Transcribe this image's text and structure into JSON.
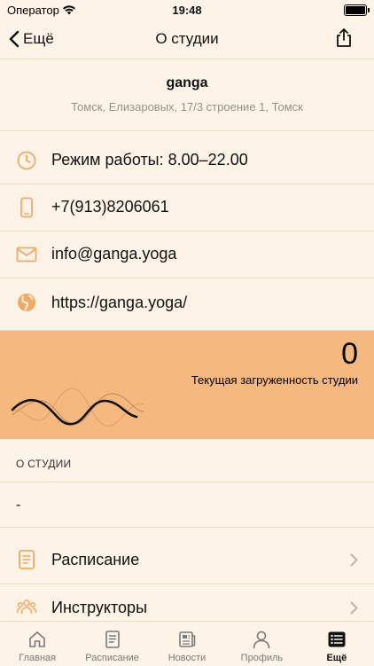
{
  "status_bar": {
    "carrier": "Оператор",
    "time": "19:48"
  },
  "nav": {
    "back_label": "Ещё",
    "title": "О студии"
  },
  "studio": {
    "name": "ganga",
    "address": "Томск, Елизаровых, 17/3 строение 1, Томск"
  },
  "contacts": {
    "hours": "Режим работы: 8.00–22.00",
    "phone": "+7(913)8206061",
    "email": "info@ganga.yoga",
    "website": "https://ganga.yoga/"
  },
  "load": {
    "value": "0",
    "label": "Текущая загруженность студии"
  },
  "about": {
    "section_title": "О СТУДИИ",
    "text": "-",
    "items": [
      {
        "label": "Расписание",
        "icon": "document-icon"
      },
      {
        "label": "Инструкторы",
        "icon": "people-icon"
      }
    ]
  },
  "tabs": [
    {
      "label": "Главная",
      "icon": "home-icon",
      "active": false
    },
    {
      "label": "Расписание",
      "icon": "schedule-icon",
      "active": false
    },
    {
      "label": "Новости",
      "icon": "news-icon",
      "active": false
    },
    {
      "label": "Профиль",
      "icon": "profile-icon",
      "active": false
    },
    {
      "label": "Ещё",
      "icon": "more-icon",
      "active": true
    }
  ],
  "colors": {
    "background": "#fdf3e6",
    "accent": "#f5b87f",
    "icon": "#f0a966",
    "divider": "#ead9c4"
  }
}
